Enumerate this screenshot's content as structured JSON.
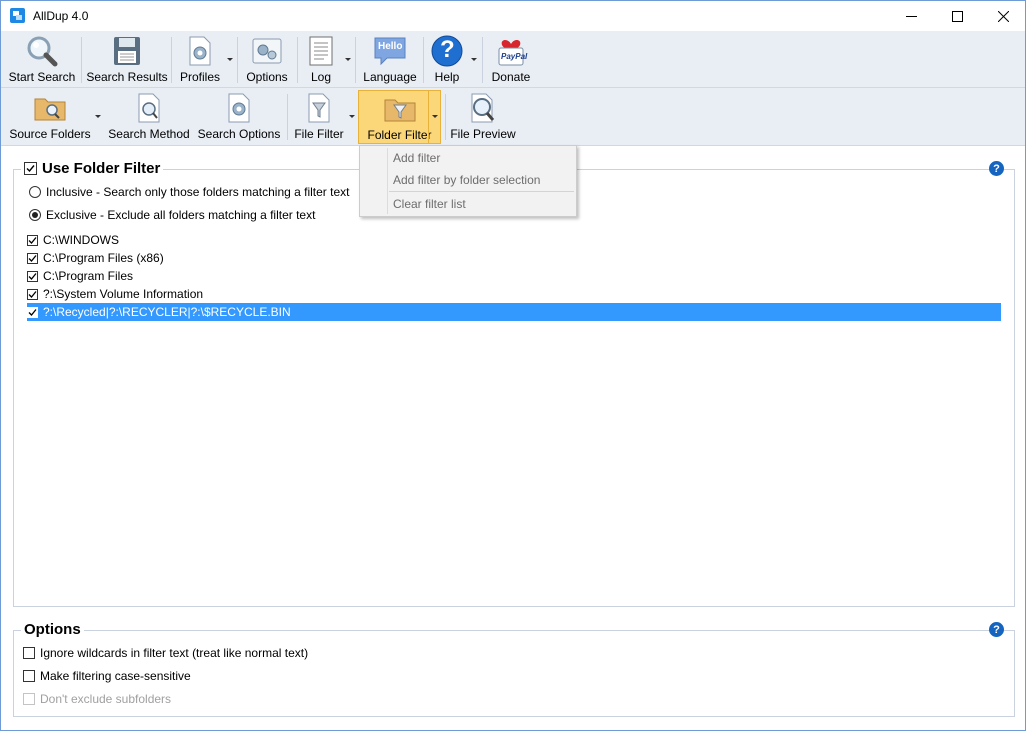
{
  "window": {
    "title": "AllDup 4.0"
  },
  "toolbar_main": [
    {
      "id": "start-search",
      "label": "Start Search",
      "icon": "magnifier-icon"
    },
    {
      "id": "search-results",
      "label": "Search Results",
      "icon": "floppy-disk-icon"
    },
    {
      "id": "profiles",
      "label": "Profiles",
      "icon": "profile-gear-icon"
    },
    {
      "id": "options",
      "label": "Options",
      "icon": "gears-icon"
    },
    {
      "id": "log",
      "label": "Log",
      "icon": "log-document-icon"
    },
    {
      "id": "language",
      "label": "Language",
      "icon": "hello-speech-bubble-icon"
    },
    {
      "id": "help",
      "label": "Help",
      "icon": "question-mark-icon"
    },
    {
      "id": "donate",
      "label": "Donate",
      "icon": "paypal-heart-icon"
    }
  ],
  "language_bubble_text": "Hello",
  "paypal_text": "PayPal",
  "toolbar_sub": [
    {
      "id": "source-folders",
      "label": "Source Folders",
      "icon": "folder-magnifier-icon"
    },
    {
      "id": "search-method",
      "label": "Search Method",
      "icon": "document-magnifier-icon"
    },
    {
      "id": "search-options",
      "label": "Search Options",
      "icon": "document-gear-icon"
    },
    {
      "id": "file-filter",
      "label": "File Filter",
      "icon": "funnel-document-icon"
    },
    {
      "id": "folder-filter",
      "label": "Folder Filter",
      "icon": "funnel-folder-icon"
    },
    {
      "id": "file-preview",
      "label": "File Preview",
      "icon": "preview-magnifier-icon"
    }
  ],
  "folder_filter": {
    "title": "Use Folder Filter",
    "enabled": true,
    "mode_inclusive": "Inclusive - Search only those folders matching a filter text",
    "mode_exclusive": "Exclusive - Exclude all folders matching a filter text",
    "selected_mode": "exclusive",
    "filters": [
      {
        "text": "C:\\WINDOWS",
        "checked": true,
        "selected": false
      },
      {
        "text": "C:\\Program Files (x86)",
        "checked": true,
        "selected": false
      },
      {
        "text": "C:\\Program Files",
        "checked": true,
        "selected": false
      },
      {
        "text": "?:\\System Volume Information",
        "checked": true,
        "selected": false
      },
      {
        "text": "?:\\Recycled|?:\\RECYCLER|?:\\$RECYCLE.BIN",
        "checked": true,
        "selected": true
      }
    ]
  },
  "folder_filter_menu": {
    "items": [
      "Add filter",
      "Add filter by folder selection",
      "Clear filter list"
    ]
  },
  "options": {
    "title": "Options",
    "items": [
      {
        "label": "Ignore wildcards in filter text (treat like normal text)",
        "checked": false,
        "enabled": true
      },
      {
        "label": "Make filtering case-sensitive",
        "checked": false,
        "enabled": true
      },
      {
        "label": "Don't exclude subfolders",
        "checked": false,
        "enabled": false
      }
    ]
  },
  "help_glyph": "?",
  "colors": {
    "accent": "#3399ff",
    "active_button": "#fbd77a",
    "toolbar_bg": "#e9eef5",
    "help": "#1565c0"
  }
}
